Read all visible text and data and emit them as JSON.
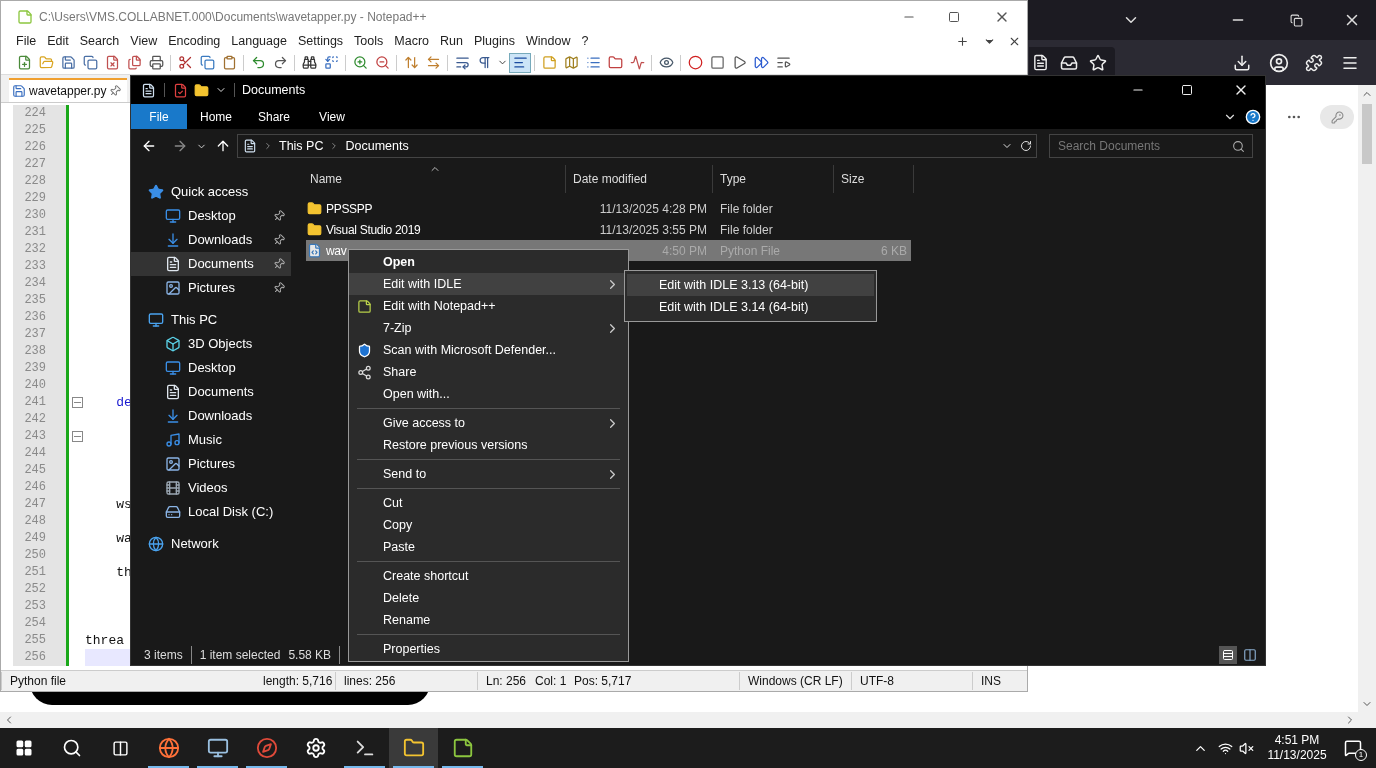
{
  "notepad": {
    "title": "C:\\Users\\VMS.COLLABNET.000\\Documents\\wavetapper.py - Notepad++",
    "menu": [
      "File",
      "Edit",
      "Search",
      "View",
      "Encoding",
      "Language",
      "Settings",
      "Tools",
      "Macro",
      "Run",
      "Plugins",
      "Window",
      "?"
    ],
    "toolbar": [
      {
        "kind": "new",
        "on": false
      },
      {
        "kind": "open",
        "on": false
      },
      {
        "kind": "save",
        "on": false
      },
      {
        "kind": "save-all",
        "on": false
      },
      {
        "kind": "close",
        "on": false
      },
      {
        "kind": "close-all",
        "on": false
      },
      {
        "kind": "print",
        "on": false
      },
      {
        "kind": "cut",
        "on": false
      },
      {
        "kind": "copy",
        "on": false
      },
      {
        "kind": "paste",
        "on": false
      },
      {
        "kind": "undo",
        "on": false
      },
      {
        "kind": "redo",
        "on": false
      },
      {
        "kind": "find",
        "on": false
      },
      {
        "kind": "replace",
        "on": false
      },
      {
        "kind": "zoom-in",
        "on": false
      },
      {
        "kind": "zoom-out",
        "on": false
      },
      {
        "kind": "sync-v",
        "on": false
      },
      {
        "kind": "sync-h",
        "on": false
      },
      {
        "kind": "wrap",
        "on": false
      },
      {
        "kind": "pilcrow",
        "on": false
      },
      {
        "kind": "dropdown",
        "on": false
      },
      {
        "kind": "indent",
        "on": true
      },
      {
        "kind": "lang",
        "on": false
      },
      {
        "kind": "map",
        "on": false
      },
      {
        "kind": "list",
        "on": false
      },
      {
        "kind": "folder",
        "on": false
      },
      {
        "kind": "monitor",
        "on": false
      },
      {
        "kind": "eye",
        "on": false
      },
      {
        "kind": "record",
        "on": false
      },
      {
        "kind": "stop",
        "on": false
      },
      {
        "kind": "play",
        "on": false
      },
      {
        "kind": "play-many",
        "on": false
      },
      {
        "kind": "save-macro",
        "on": false
      }
    ],
    "tab": {
      "label": "wavetapper.py"
    },
    "lines": [
      {
        "number": "224",
        "fold": false,
        "current": false
      },
      {
        "number": "225",
        "fold": false,
        "current": false
      },
      {
        "number": "226",
        "fold": false,
        "current": false
      },
      {
        "number": "227",
        "fold": false,
        "current": false
      },
      {
        "number": "228",
        "fold": false,
        "current": false
      },
      {
        "number": "229",
        "fold": false,
        "current": false
      },
      {
        "number": "230",
        "fold": false,
        "current": false
      },
      {
        "number": "231",
        "fold": false,
        "current": false
      },
      {
        "number": "232",
        "fold": false,
        "current": false
      },
      {
        "number": "233",
        "fold": false,
        "current": false
      },
      {
        "number": "234",
        "fold": false,
        "current": false
      },
      {
        "number": "235",
        "fold": false,
        "current": false
      },
      {
        "number": "236",
        "fold": false,
        "current": false
      },
      {
        "number": "237",
        "fold": false,
        "current": false
      },
      {
        "number": "238",
        "fold": false,
        "current": false
      },
      {
        "number": "239",
        "fold": false,
        "current": false
      },
      {
        "number": "240",
        "fold": false,
        "current": false
      },
      {
        "number": "241",
        "fold": true,
        "current": false,
        "code": "    de",
        "color": "#1a1ad0"
      },
      {
        "number": "242",
        "fold": false,
        "current": false
      },
      {
        "number": "243",
        "fold": true,
        "current": false
      },
      {
        "number": "244",
        "fold": false,
        "current": false
      },
      {
        "number": "245",
        "fold": false,
        "current": false
      },
      {
        "number": "246",
        "fold": false,
        "current": false
      },
      {
        "number": "247",
        "fold": false,
        "current": false,
        "code": "    ws",
        "color": "#111111"
      },
      {
        "number": "248",
        "fold": false,
        "current": false
      },
      {
        "number": "249",
        "fold": false,
        "current": false,
        "code": "    wa",
        "color": "#111111"
      },
      {
        "number": "250",
        "fold": false,
        "current": false
      },
      {
        "number": "251",
        "fold": false,
        "current": false,
        "code": "    th",
        "color": "#111111"
      },
      {
        "number": "252",
        "fold": false,
        "current": false
      },
      {
        "number": "253",
        "fold": false,
        "current": false
      },
      {
        "number": "254",
        "fold": false,
        "current": false
      },
      {
        "number": "255",
        "fold": false,
        "current": false,
        "code": "threa",
        "color": "#111111"
      },
      {
        "number": "256",
        "fold": false,
        "current": true
      }
    ],
    "status_bar": [
      "Python file",
      "length: 5,716",
      "lines: 256",
      "Ln: 256",
      "Col: 1",
      "Pos: 5,717",
      "Windows (CR LF)",
      "UTF-8",
      "INS"
    ]
  },
  "explorer": {
    "title": "Documents",
    "ribbon_tabs": [
      {
        "label": "File",
        "selected": true
      },
      {
        "label": "Home",
        "selected": false
      },
      {
        "label": "Share",
        "selected": false
      },
      {
        "label": "View",
        "selected": false
      }
    ],
    "breadcrumb": [
      "This PC",
      "Documents"
    ],
    "search": {
      "placeholder": "Search Documents"
    },
    "nav": [
      {
        "label": "Quick access",
        "kind": "star",
        "selected": false,
        "pinned": false,
        "children": [
          {
            "label": "Desktop",
            "kind": "desktop",
            "selected": false,
            "pinned": true
          },
          {
            "label": "Downloads",
            "kind": "downloads",
            "selected": false,
            "pinned": true
          },
          {
            "label": "Documents",
            "kind": "documents",
            "selected": true,
            "pinned": true
          },
          {
            "label": "Pictures",
            "kind": "pictures",
            "selected": false,
            "pinned": true
          }
        ]
      },
      {
        "label": "This PC",
        "kind": "pc",
        "selected": false,
        "pinned": false,
        "children": [
          {
            "label": "3D Objects",
            "kind": "objects",
            "selected": false,
            "pinned": false
          },
          {
            "label": "Desktop",
            "kind": "desktop",
            "selected": false,
            "pinned": false
          },
          {
            "label": "Documents",
            "kind": "documents",
            "selected": false,
            "pinned": false
          },
          {
            "label": "Downloads",
            "kind": "downloads",
            "selected": false,
            "pinned": false
          },
          {
            "label": "Music",
            "kind": "music",
            "selected": false,
            "pinned": false
          },
          {
            "label": "Pictures",
            "kind": "pictures",
            "selected": false,
            "pinned": false
          },
          {
            "label": "Videos",
            "kind": "videos",
            "selected": false,
            "pinned": false
          },
          {
            "label": "Local Disk (C:)",
            "kind": "disk",
            "selected": false,
            "pinned": false
          }
        ]
      },
      {
        "label": "Network",
        "kind": "network",
        "selected": false,
        "pinned": false
      }
    ],
    "columns": [
      "Name",
      "Date modified",
      "Type",
      "Size"
    ],
    "rows": [
      {
        "kind": "folder",
        "name": "PPSSPP",
        "date": "11/13/2025 4:28 PM",
        "type": "File folder",
        "selected": false
      },
      {
        "kind": "folder",
        "name": "Visual Studio 2019",
        "date": "11/13/2025 3:55 PM",
        "type": "File folder",
        "selected": false
      },
      {
        "kind": "python",
        "name": "wav",
        "date": "4:50 PM",
        "type": "Python File",
        "size": "6 KB",
        "selected": true
      }
    ],
    "status": [
      "3 items",
      "1 item selected",
      "5.58 KB"
    ]
  },
  "context_menu": [
    [
      {
        "label": "Open",
        "kind": "plain",
        "bold": true,
        "submenu": false,
        "selected": false
      },
      {
        "label": "Edit with IDLE",
        "kind": "plain",
        "bold": false,
        "submenu": true,
        "selected": true
      },
      {
        "label": "Edit with Notepad++",
        "kind": "notepad",
        "bold": false,
        "submenu": false,
        "selected": false
      },
      {
        "label": "7-Zip",
        "kind": "plain",
        "bold": false,
        "submenu": true,
        "selected": false
      },
      {
        "label": "Scan with Microsoft Defender...",
        "kind": "defender",
        "bold": false,
        "submenu": false,
        "selected": false
      },
      {
        "label": "Share",
        "kind": "share",
        "bold": false,
        "submenu": false,
        "selected": false
      },
      {
        "label": "Open with...",
        "kind": "plain",
        "bold": false,
        "submenu": false,
        "selected": false
      }
    ],
    [
      {
        "label": "Give access to",
        "kind": "plain",
        "bold": false,
        "submenu": true,
        "selected": false
      },
      {
        "label": "Restore previous versions",
        "kind": "plain",
        "bold": false,
        "submenu": false,
        "selected": false
      }
    ],
    [
      {
        "label": "Send to",
        "kind": "plain",
        "bold": false,
        "submenu": true,
        "selected": false
      }
    ],
    [
      {
        "label": "Cut",
        "kind": "plain",
        "bold": false,
        "submenu": false,
        "selected": false
      },
      {
        "label": "Copy",
        "kind": "plain",
        "bold": false,
        "submenu": false,
        "selected": false
      },
      {
        "label": "Paste",
        "kind": "plain",
        "bold": false,
        "submenu": false,
        "selected": false
      }
    ],
    [
      {
        "label": "Create shortcut",
        "kind": "plain",
        "bold": false,
        "submenu": false,
        "selected": false
      },
      {
        "label": "Delete",
        "kind": "plain",
        "bold": false,
        "submenu": false,
        "selected": false
      },
      {
        "label": "Rename",
        "kind": "plain",
        "bold": false,
        "submenu": false,
        "selected": false
      }
    ],
    [
      {
        "label": "Properties",
        "kind": "plain",
        "bold": false,
        "submenu": false,
        "selected": false
      }
    ]
  ],
  "submenu": [
    {
      "label": "Edit with IDLE 3.13 (64-bit)",
      "selected": true
    },
    {
      "label": "Edit with IDLE 3.14 (64-bit)",
      "selected": false
    }
  ],
  "taskbar": {
    "apps": [
      {
        "kind": "firefox",
        "running": true,
        "active": false
      },
      {
        "kind": "remote",
        "running": true,
        "active": false
      },
      {
        "kind": "compass",
        "running": true,
        "active": false
      },
      {
        "kind": "settings",
        "running": false,
        "active": false
      },
      {
        "kind": "terminal",
        "running": true,
        "active": false
      },
      {
        "kind": "explorer",
        "running": true,
        "active": true
      },
      {
        "kind": "notepad",
        "running": true,
        "active": false
      }
    ],
    "time": "4:51 PM",
    "date": "11/13/2025",
    "notification_count": "1"
  }
}
